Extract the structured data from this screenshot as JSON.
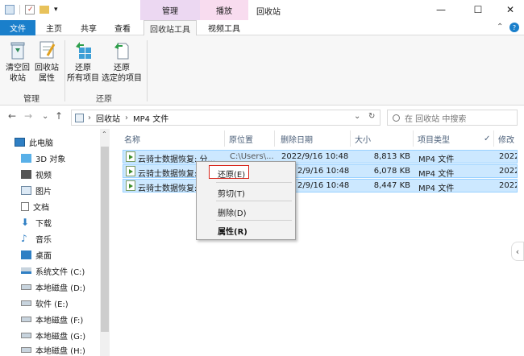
{
  "window": {
    "title": "回收站",
    "contextual_manage": "管理",
    "contextual_play": "播放",
    "minimize": "—",
    "maximize": "☐",
    "close": "✕"
  },
  "tabs": {
    "file": "文件",
    "home": "主页",
    "share": "共享",
    "view": "查看",
    "recycle_tools": "回收站工具",
    "video_tools": "视频工具",
    "collapse": "⌃",
    "help": "?"
  },
  "ribbon": {
    "empty_bin": [
      "清空回",
      "收站"
    ],
    "bin_props": [
      "回收站",
      "属性"
    ],
    "group_manage": "管理",
    "restore_all": [
      "还原",
      "所有项目"
    ],
    "restore_selected": [
      "还原",
      "选定的项目"
    ],
    "group_restore": "还原"
  },
  "address": {
    "back": "←",
    "forward": "→",
    "history": "⌄",
    "up": "↑",
    "path_sep1": "›",
    "crumb1": "回收站",
    "path_sep2": "›",
    "crumb2": "MP4 文件",
    "dropdown": "⌄",
    "refresh": "↻",
    "search_placeholder": "在 回收站 中搜索"
  },
  "nav": {
    "items": [
      "此电脑",
      "3D 对象",
      "视频",
      "图片",
      "文档",
      "下载",
      "音乐",
      "桌面",
      "系统文件 (C:)",
      "本地磁盘 (D:)",
      "软件 (E:)",
      "本地磁盘 (F:)",
      "本地磁盘 (G:)",
      "本地磁盘 (H:)"
    ]
  },
  "columns": {
    "name": "名称",
    "origin": "原位置",
    "deleted": "删除日期",
    "size": "大小",
    "type": "项目类型",
    "modified": "修改",
    "check": "✓",
    "sort_up": "⌃"
  },
  "files": [
    {
      "name": "云骑士数据恢复: 分...",
      "origin": "C:\\Users\\...",
      "deleted": "2022/9/16 10:48",
      "size": "8,813 KB",
      "type": "MP4 文件",
      "modified": "2022"
    },
    {
      "name": "云骑士数据恢复:",
      "origin": "",
      "deleted": "2/9/16 10:48",
      "size": "6,078 KB",
      "type": "MP4 文件",
      "modified": "2022"
    },
    {
      "name": "云骑士数据恢复:",
      "origin": "",
      "deleted": "2/9/16 10:48",
      "size": "8,447 KB",
      "type": "MP4 文件",
      "modified": "2022"
    }
  ],
  "context_menu": {
    "restore": "还原(E)",
    "cut": "剪切(T)",
    "delete": "删除(D)",
    "properties": "属性(R)"
  },
  "side_expand": "‹",
  "colors": {
    "file_tab": "#1a7fcb",
    "selection": "#cce8ff",
    "highlight_box": "#d9261c"
  }
}
